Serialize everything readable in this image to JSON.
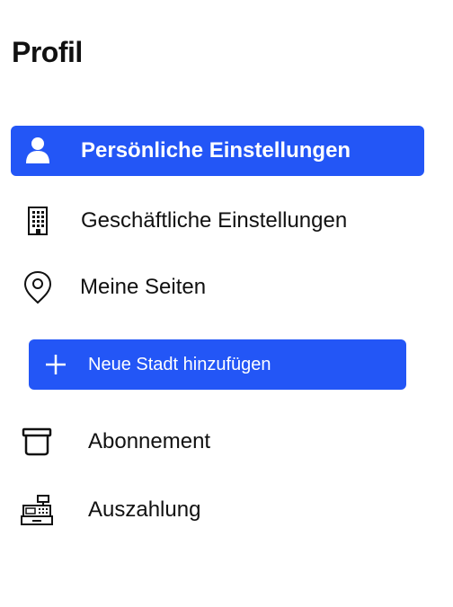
{
  "header": {
    "title": "Profil"
  },
  "nav": {
    "items": [
      {
        "label": "Persönliche Einstellungen",
        "icon": "user-icon",
        "active": true
      },
      {
        "label": "Geschäftliche Einstellungen",
        "icon": "building-icon",
        "active": false
      },
      {
        "label": "Meine Seiten",
        "icon": "location-pin-icon",
        "active": false
      }
    ],
    "add_city": {
      "label": "Neue Stadt hinzufügen",
      "icon": "plus-icon"
    },
    "more": [
      {
        "label": "Abonnement",
        "icon": "archive-box-icon"
      },
      {
        "label": "Auszahlung",
        "icon": "cash-register-icon"
      }
    ]
  },
  "colors": {
    "accent": "#2356f6",
    "text": "#111111",
    "background": "#ffffff"
  }
}
